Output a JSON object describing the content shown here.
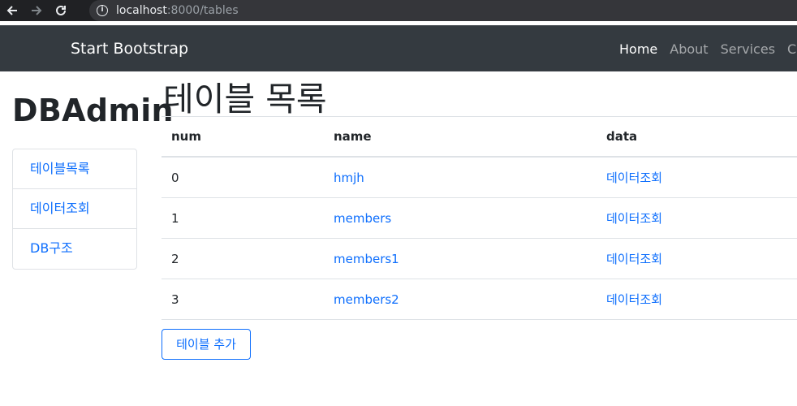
{
  "browser": {
    "url_host": "localhost",
    "url_path": ":8000/tables",
    "back_icon": "arrow-left-icon",
    "forward_icon": "arrow-right-icon",
    "reload_icon": "reload-icon",
    "info_icon": "info-icon"
  },
  "navbar": {
    "brand": "Start Bootstrap",
    "links": [
      {
        "label": "Home",
        "active": true
      },
      {
        "label": "About",
        "active": false
      },
      {
        "label": "Services",
        "active": false
      },
      {
        "label": "Con",
        "active": false
      }
    ]
  },
  "sidebar": {
    "title": "DBAdmin",
    "items": [
      {
        "label": "테이블목록"
      },
      {
        "label": "데이터조회"
      },
      {
        "label": "DB구조"
      }
    ]
  },
  "main": {
    "title": "테이블 목록",
    "columns": [
      "num",
      "name",
      "data"
    ],
    "rows": [
      {
        "num": "0",
        "name": "hmjh",
        "data": "데이터조회"
      },
      {
        "num": "1",
        "name": "members",
        "data": "데이터조회"
      },
      {
        "num": "2",
        "name": "members1",
        "data": "데이터조회"
      },
      {
        "num": "3",
        "name": "members2",
        "data": "데이터조회"
      }
    ],
    "add_button": "테이블 추가"
  },
  "colors": {
    "navbar_bg": "#343a40",
    "link": "#0d6efd",
    "chrome_bg": "#202124"
  }
}
